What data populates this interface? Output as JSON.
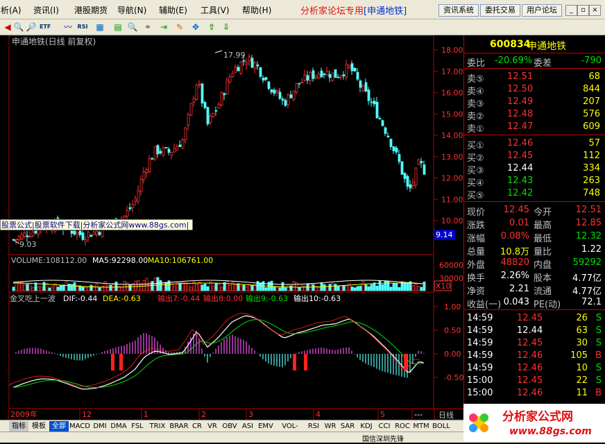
{
  "menu": {
    "items": [
      "析(A)",
      "资讯(I)",
      "港股期货",
      "导航(N)",
      "辅助(E)",
      "工具(V)",
      "帮助(H)"
    ],
    "title_main": "分析家论坛专用",
    "title_stock": "[申通地铁]",
    "buttons": [
      "资讯系统",
      "委托交易",
      "用户论坛"
    ]
  },
  "chart": {
    "title": "申通地铁(日线 前复权)",
    "high_label": "17.99",
    "low_label": "9.03",
    "current_tag": "9.14",
    "price_ticks": [
      "18.00",
      "17.00",
      "16.00",
      "15.00",
      "14.00",
      "13.00",
      "12.00",
      "11.00",
      "10.00"
    ],
    "watermark": "股票公式|股票软件下载|分析家公式网www.88gs.com|",
    "volume_header": {
      "vol": "VOLUME:108112.00",
      "ma5": "MA5:92298.00",
      "ma10": "MA10:106761.00"
    },
    "volume_ticks": [
      "60000",
      "30000"
    ],
    "volume_unit": "X10",
    "indicator_header": {
      "name": "金叉吃上一波",
      "dif": "DIF:-0.44",
      "dea": "DEA:-0.63",
      "out7": "输出7:-0.44",
      "out8": "输出8:0.00",
      "out9": "输出9:-0.63",
      "out10": "输出10:-0.63"
    },
    "indicator_ticks": [
      "1.00",
      "0.50",
      "0.00",
      "-0.50"
    ],
    "date_labels": [
      "2009年",
      "12",
      "1",
      "2",
      "3",
      "4",
      "5",
      "---"
    ],
    "period_label": "日线"
  },
  "colors": {
    "up": "#ff3232",
    "down": "#54ffff",
    "grid": "#b00000",
    "yellow": "#ffff00",
    "green": "#00e000",
    "magenta": "#ff55ff"
  },
  "quote": {
    "code": "600834",
    "name": "申通地铁",
    "weibi_label": "委比",
    "weibi_value": "-20.69%",
    "weicha_label": "委差",
    "weicha_value": "-790",
    "asks": [
      {
        "label": "卖⑤",
        "price": "12.51",
        "vol": "68"
      },
      {
        "label": "卖④",
        "price": "12.50",
        "vol": "844"
      },
      {
        "label": "卖③",
        "price": "12.49",
        "vol": "207"
      },
      {
        "label": "卖②",
        "price": "12.48",
        "vol": "576"
      },
      {
        "label": "卖①",
        "price": "12.47",
        "vol": "609"
      }
    ],
    "bids": [
      {
        "label": "买①",
        "price": "12.46",
        "vol": "57"
      },
      {
        "label": "买②",
        "price": "12.45",
        "vol": "112"
      },
      {
        "label": "买③",
        "price": "12.44",
        "vol": "334"
      },
      {
        "label": "买④",
        "price": "12.43",
        "vol": "263"
      },
      {
        "label": "买⑤",
        "price": "12.42",
        "vol": "748"
      }
    ],
    "stats": [
      {
        "l1": "现价",
        "v1": "12.45",
        "l2": "今开",
        "v2": "12.51"
      },
      {
        "l1": "涨跌",
        "v1": "0.01",
        "l2": "最高",
        "v2": "12.85"
      },
      {
        "l1": "涨幅",
        "v1": "0.08%",
        "l2": "最低",
        "v2": "12.32"
      },
      {
        "l1": "总量",
        "v1": "10.8万",
        "l2": "量比",
        "v2": "1.22"
      },
      {
        "l1": "外盘",
        "v1": "48820",
        "l2": "内盘",
        "v2": "59292"
      },
      {
        "l1": "换手",
        "v1": "2.26%",
        "l2": "股本",
        "v2": "4.77亿"
      },
      {
        "l1": "净资",
        "v1": "2.21",
        "l2": "流通",
        "v2": "4.77亿"
      },
      {
        "l1": "收益(一)",
        "v1": "0.043",
        "l2": "PE(动)",
        "v2": "72.1"
      }
    ],
    "ticks": [
      {
        "time": "14:59",
        "price": "12.45",
        "vol": "26",
        "side": "S"
      },
      {
        "time": "14:59",
        "price": "12.44",
        "vol": "63",
        "side": "S"
      },
      {
        "time": "14:59",
        "price": "12.45",
        "vol": "30",
        "side": "S"
      },
      {
        "time": "14:59",
        "price": "12.46",
        "vol": "105",
        "side": "B"
      },
      {
        "time": "14:59",
        "price": "12.46",
        "vol": "10",
        "side": "S"
      },
      {
        "time": "15:00",
        "price": "12.45",
        "vol": "22",
        "side": "S"
      },
      {
        "time": "15:00",
        "price": "12.46",
        "vol": "11",
        "side": "B"
      }
    ]
  },
  "bottom_tabs": [
    "指标",
    "模板",
    "全部",
    "MACD",
    "DMI",
    "DMA",
    "FSL",
    "TRIX",
    "BRAR",
    "CR",
    "VR",
    "OBV",
    "ASI",
    "EMV",
    "VOL-TDX",
    "RSI",
    "WR",
    "SAR",
    "KDJ",
    "CCI",
    "ROC",
    "MTM",
    "BOLL"
  ],
  "logo": {
    "cn": "分析家公式网",
    "url": "www.88gs.com"
  },
  "status": {
    "text": "国信深圳先锋"
  }
}
